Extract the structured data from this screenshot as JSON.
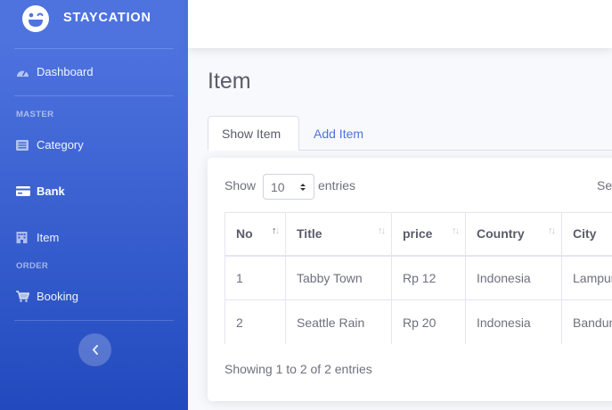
{
  "brand": {
    "name": "STAYCATION",
    "icon": "laugh-wink-icon"
  },
  "sidebar": {
    "dashboard": {
      "label": "Dashboard",
      "icon": "tachometer-icon"
    },
    "heading_master": "MASTER",
    "category": {
      "label": "Category",
      "icon": "list-icon"
    },
    "bank": {
      "label": "Bank",
      "icon": "credit-card-icon"
    },
    "item": {
      "label": "Item",
      "icon": "building-icon"
    },
    "heading_order": "ORDER",
    "booking": {
      "label": "Booking",
      "icon": "cart-icon"
    },
    "toggle_icon": "chevron-left-icon"
  },
  "page": {
    "title": "Item"
  },
  "tabs": {
    "show_item": "Show Item",
    "add_item": "Add Item"
  },
  "table_controls": {
    "show": "Show",
    "length_value": "10",
    "entries": "entries",
    "search_label": "Se"
  },
  "table": {
    "headers": {
      "no": "No",
      "title": "Title",
      "price": "price",
      "country": "Country",
      "city": "City"
    },
    "rows": [
      {
        "no": "1",
        "title": "Tabby Town",
        "price": "Rp 12",
        "country": "Indonesia",
        "city": "Lampung"
      },
      {
        "no": "2",
        "title": "Seattle Rain",
        "price": "Rp 20",
        "country": "Indonesia",
        "city": "Bandung"
      }
    ]
  },
  "info": "Showing 1 to 2 of 2 entries",
  "colors": {
    "primary": "#4e73df",
    "primary_dark": "#224abe",
    "text": "#5a5c69"
  }
}
